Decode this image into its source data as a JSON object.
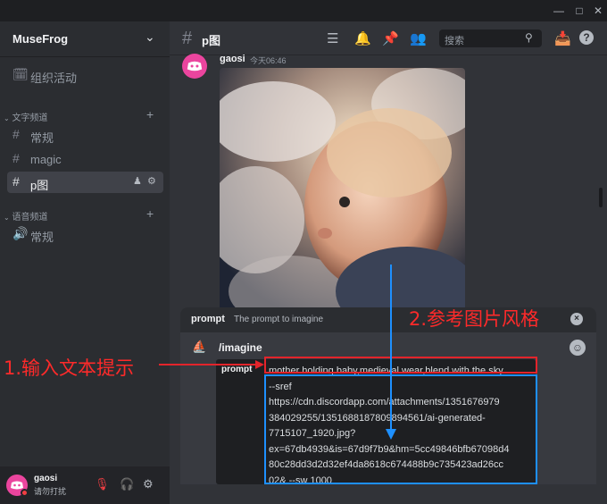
{
  "window": {
    "minimize_icon": "minimize-icon",
    "maximize_icon": "maximize-icon",
    "close_icon": "close-icon"
  },
  "server": {
    "name": "MuseFrog"
  },
  "sidebar": {
    "events_label": "组织活动",
    "text_category": "文字频道",
    "text_channels": [
      {
        "label": "常规"
      },
      {
        "label": "magic"
      },
      {
        "label": "p图"
      }
    ],
    "voice_category": "语音频道",
    "voice_channels": [
      {
        "label": "常规"
      }
    ]
  },
  "user": {
    "name": "gaosi",
    "status": "请勿打扰"
  },
  "channel": {
    "name": "p图"
  },
  "search": {
    "placeholder": "搜索"
  },
  "message": {
    "author": "gaosi",
    "time": "今天06:46"
  },
  "compose": {
    "hint_option": "prompt",
    "hint_desc": "The prompt to imagine",
    "command": "/imagine",
    "option_chip": "prompt",
    "line1": "mother holding baby,medieval wear,blend with the sky",
    "rest": "--sref\nhttps://cdn.discordapp.com/attachments/1351676979\n384029255/1351688187809894561/ai-generated-\n7715107_1920.jpg?\nex=67db4939&is=67d9f7b9&hm=5cc49846bfb67098d4\n80c28dd3d2d32ef4da8618c674488b9c735423ad26cc\n02& --sw 1000"
  },
  "annotations": {
    "left_text": "1.输入文本提示",
    "right_text": "2.参考图片风格"
  },
  "colors": {
    "accent": "#5865f2",
    "red_annotation": "#e3242b",
    "blue_annotation": "#1e90ff",
    "avatar": "#eb459e"
  }
}
